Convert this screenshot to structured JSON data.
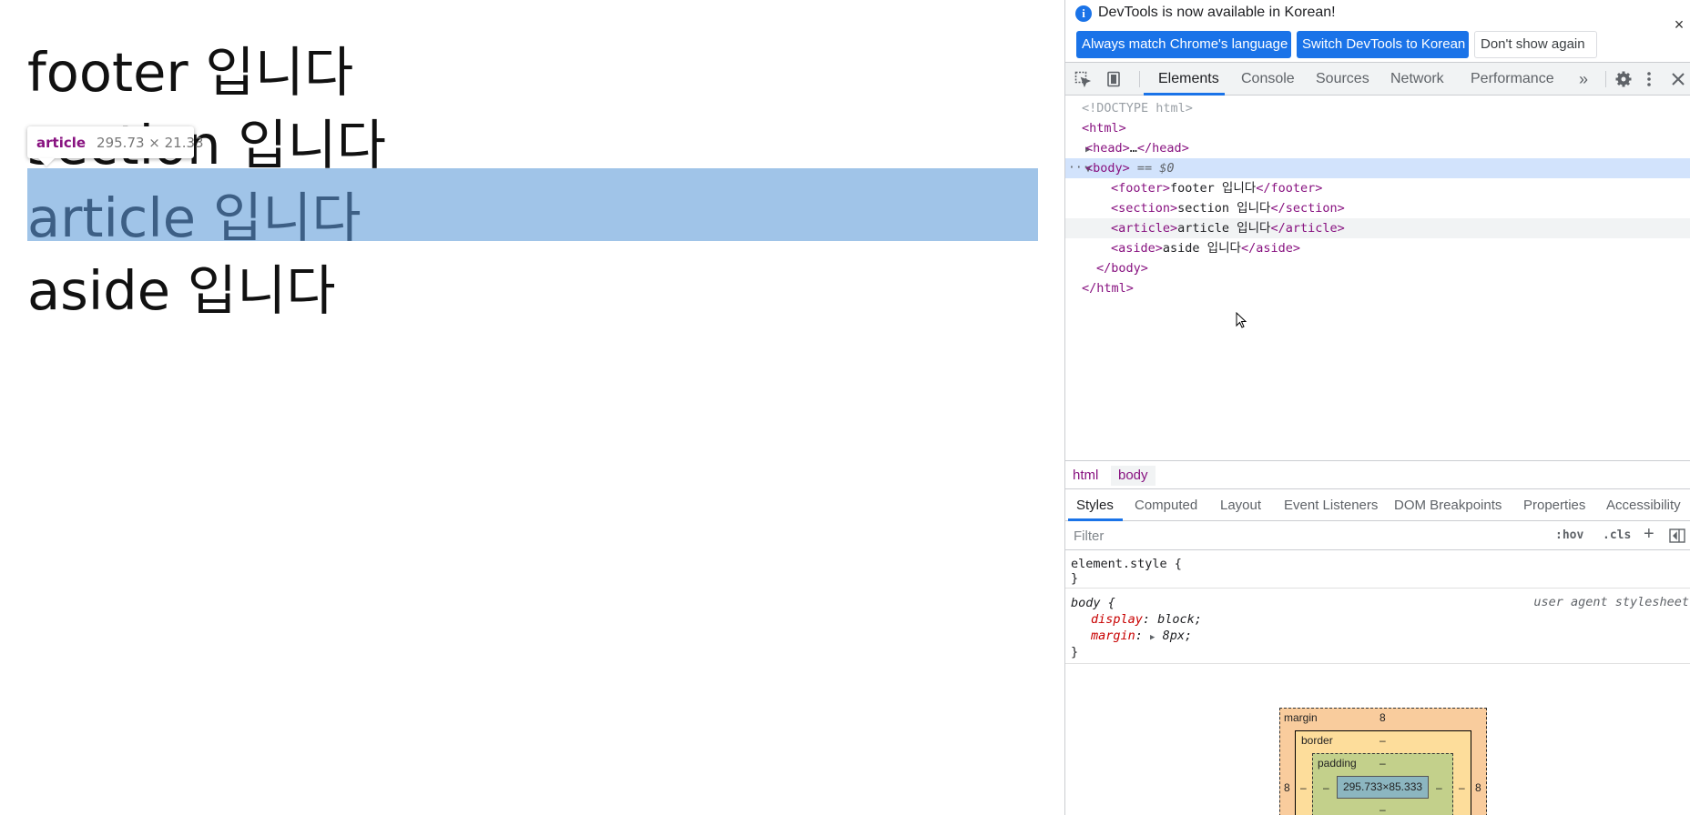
{
  "page": {
    "lines": [
      "footer 입니다",
      "section 입니다",
      "article 입니다",
      "aside 입니다"
    ]
  },
  "tooltip": {
    "tag": "article",
    "dims": "295.73 × 21.33"
  },
  "infobar": {
    "message": "DevTools is now available in Korean!",
    "btn_match": "Always match Chrome's language",
    "btn_switch": "Switch DevTools to Korean",
    "btn_dont": "Don't show again",
    "close": "×"
  },
  "toolbar": {
    "tabs": [
      "Elements",
      "Console",
      "Sources",
      "Network",
      "Performance"
    ],
    "more": "»"
  },
  "dom": {
    "doctype": "<!DOCTYPE html>",
    "html_open": "<html>",
    "head": {
      "open": "<head>",
      "ellipsis": "…",
      "close": "</head>"
    },
    "body": {
      "open": "<body>",
      "eq": " == $0"
    },
    "children": [
      {
        "open": "<footer>",
        "text": "footer 입니다",
        "close": "</footer>"
      },
      {
        "open": "<section>",
        "text": "section 입니다",
        "close": "</section>"
      },
      {
        "open": "<article>",
        "text": "article 입니다",
        "close": "</article>"
      },
      {
        "open": "<aside>",
        "text": "aside 입니다",
        "close": "</aside>"
      }
    ],
    "body_close": "</body>",
    "html_close": "</html>"
  },
  "breadcrumbs": [
    "html",
    "body"
  ],
  "subtabs": [
    "Styles",
    "Computed",
    "Layout",
    "Event Listeners",
    "DOM Breakpoints",
    "Properties",
    "Accessibility"
  ],
  "filter": {
    "placeholder": "Filter",
    "hov": ":hov",
    "cls": ".cls",
    "plus": "+"
  },
  "styles": {
    "element_style": {
      "selector": "element.style {",
      "close": "}"
    },
    "body_rule": {
      "selector": "body {",
      "source": "user agent stylesheet",
      "props": [
        {
          "name": "display",
          "value": "block;"
        },
        {
          "name": "margin",
          "value": "8px;"
        }
      ],
      "close": "}"
    }
  },
  "boxmodel": {
    "margin_label": "margin",
    "margin_top": "8",
    "margin_left": "8",
    "margin_right": "8",
    "border_label": "border",
    "border_top": "–",
    "border_left": "–",
    "border_right": "–",
    "padding_label": "padding",
    "padding_top": "–",
    "padding_left": "–",
    "padding_right": "–",
    "padding_bottom": "–",
    "content": "295.733×85.333"
  }
}
